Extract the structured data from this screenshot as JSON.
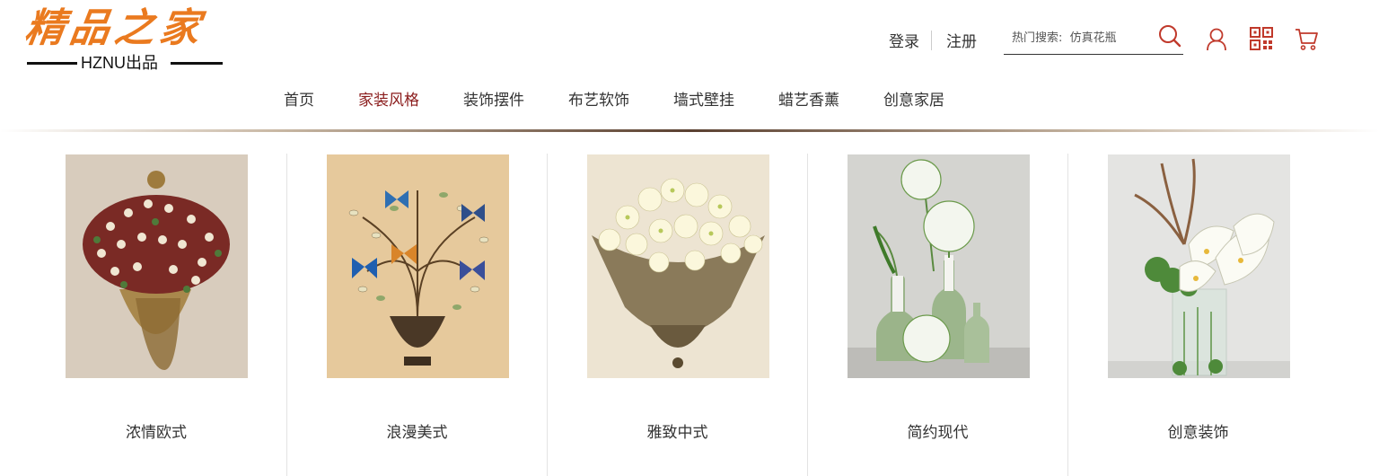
{
  "brand": {
    "logo_text": "精品之家",
    "subtitle": "HZNU出品",
    "accent": "#ea7a1f"
  },
  "auth": {
    "login": "登录",
    "register": "注册"
  },
  "search": {
    "placeholder": "热门搜索:  仿真花瓶",
    "icon": "search-icon"
  },
  "header_icons": [
    "user-icon",
    "qr-code-icon",
    "cart-icon"
  ],
  "nav": {
    "items": [
      "首页",
      "家装风格",
      "装饰摆件",
      "布艺软饰",
      "墙式壁挂",
      "蜡艺香薰",
      "创意家居"
    ],
    "active_index": 1,
    "active_color": "#8a1b1b"
  },
  "categories": [
    {
      "label": "浓情欧式"
    },
    {
      "label": "浪漫美式"
    },
    {
      "label": "雅致中式"
    },
    {
      "label": "简约现代"
    },
    {
      "label": "创意装饰"
    }
  ]
}
